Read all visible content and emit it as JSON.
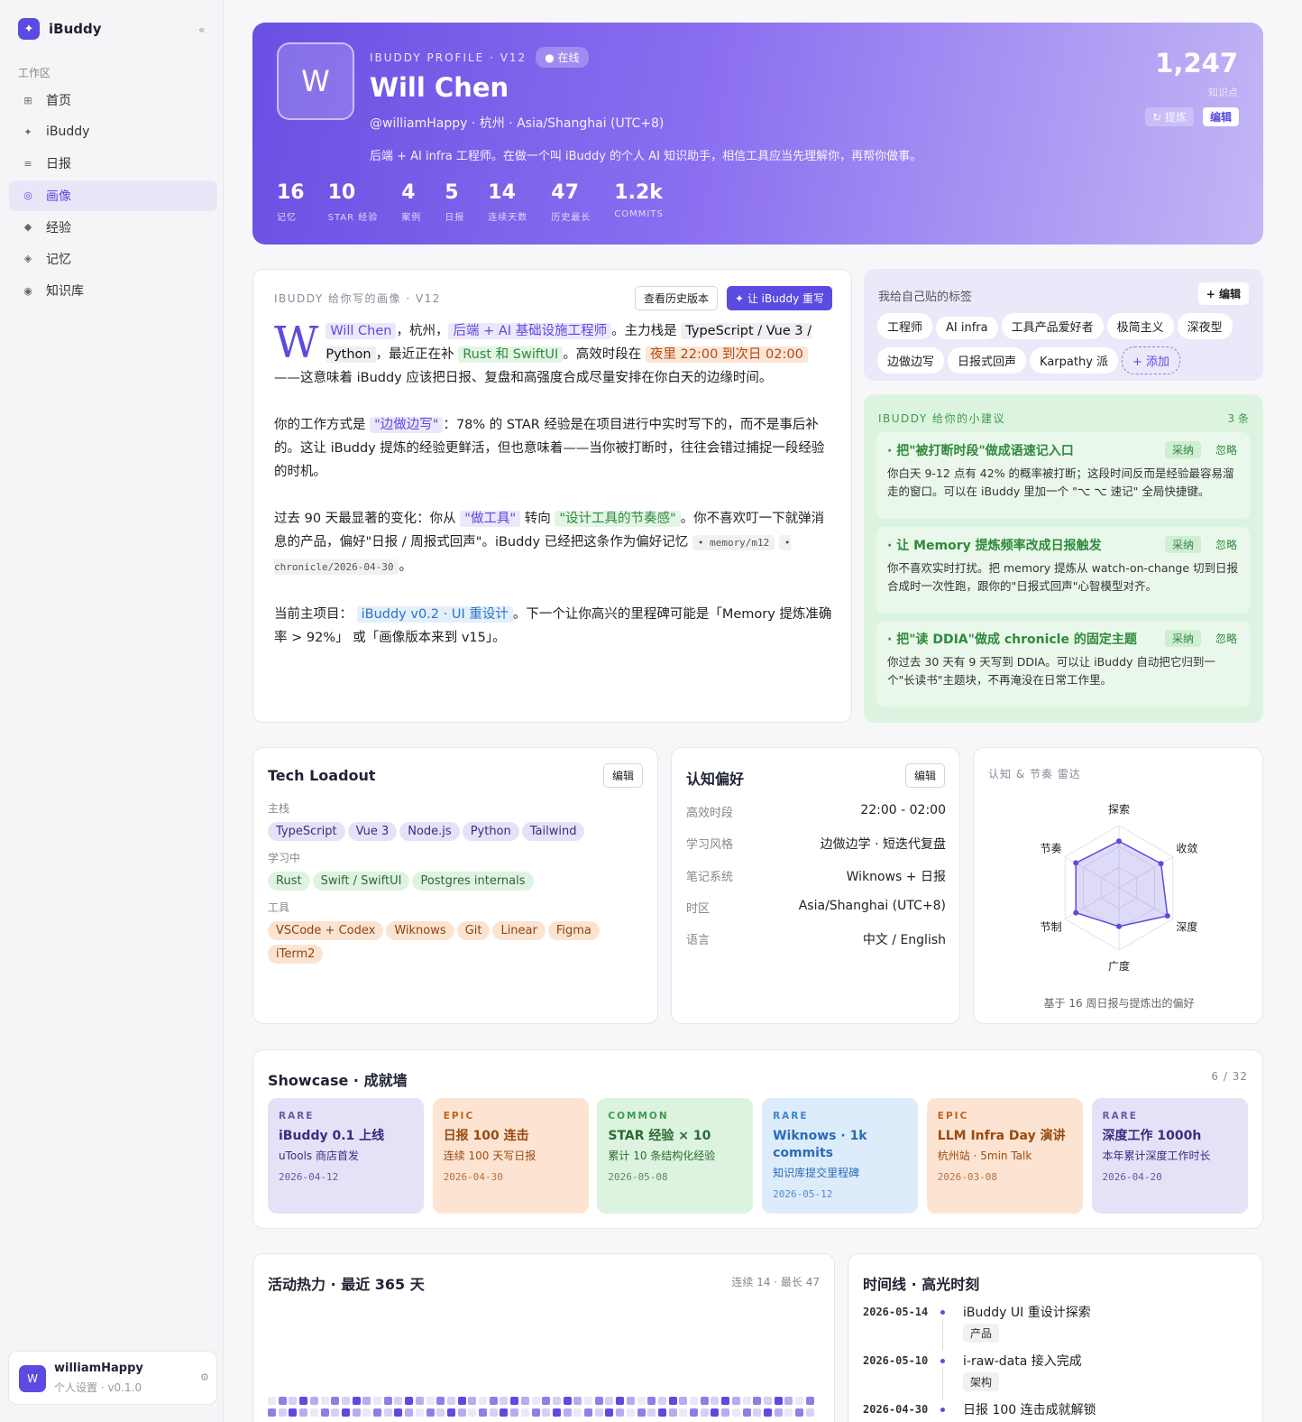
{
  "app": {
    "name": "iBuddy",
    "collapse": "«"
  },
  "sidebar": {
    "section": "工作区",
    "items": [
      {
        "label": "首页",
        "icon": "grid-icon",
        "glyph": "⊞"
      },
      {
        "label": "iBuddy",
        "icon": "sparkle-icon",
        "glyph": "✦"
      },
      {
        "label": "日报",
        "icon": "list-icon",
        "glyph": "≡"
      },
      {
        "label": "画像",
        "icon": "target-icon",
        "glyph": "◎",
        "active": true
      },
      {
        "label": "经验",
        "icon": "diamond-icon",
        "glyph": "◆"
      },
      {
        "label": "记忆",
        "icon": "diamond-outline-icon",
        "glyph": "◈"
      },
      {
        "label": "知识库",
        "icon": "record-icon",
        "glyph": "◉"
      }
    ],
    "user": {
      "avatar": "W",
      "name": "williamHappy",
      "sub": "个人设置 · v0.1.0",
      "gear": "⚙"
    }
  },
  "hero": {
    "avatar": "W",
    "kicker": "IBUDDY PROFILE · V12",
    "status": "在线",
    "name": "Will Chen",
    "handle": "@williamHappy · 杭州 · Asia/Shanghai (UTC+8)",
    "bio": "后端 + AI infra 工程师。在做一个叫 iBuddy 的个人 AI 知识助手，相信工具应当先理解你，再帮你做事。",
    "stats": [
      {
        "value": "16",
        "label": "记忆"
      },
      {
        "value": "10",
        "label": "STAR 经验"
      },
      {
        "value": "4",
        "label": "案例"
      },
      {
        "value": "5",
        "label": "日报"
      },
      {
        "value": "14",
        "label": "连续天数"
      },
      {
        "value": "47",
        "label": "历史最长"
      },
      {
        "value": "1.2k",
        "label": "COMMITS"
      }
    ],
    "count": "1,247",
    "count_label": "知识点",
    "refine": "↻ 提炼",
    "edit": "编辑"
  },
  "portrait": {
    "kicker": "IBUDDY 给你写的画像 · V12",
    "history_btn": "查看历史版本",
    "rewrite_btn": "✦ 让 iBuddy 重写",
    "dropcap": "W",
    "p1": {
      "name": "Will Chen",
      "t1": "，杭州，",
      "role": "后端 + AI 基础设施工程师",
      "t2": "。主力栈是",
      "stack": "TypeScript / Vue 3 / Python",
      "t3": "，最近正在补",
      "learning": "Rust 和 SwiftUI",
      "t4": "。高效时段在",
      "hours": "夜里 22:00 到次日 02:00",
      "t5": "——这意味着 iBuddy 应该把日报、复盘和高强度合成尽量安排在你白天的边缘时间。"
    },
    "p2": {
      "t1": "你的工作方式是",
      "style": "\"边做边写\"",
      "t2": "：78% 的 STAR 经验是在项目进行中实时写下的，而不是事后补的。这让 iBuddy 提炼的经验更鲜活，但也意味着——当你被打断时，往往会错过捕捉一段经验的时机。"
    },
    "p3": {
      "t1": "过去 90 天最显著的变化：你从",
      "from": "\"做工具\"",
      "t2": "转向",
      "to": "\"设计工具的节奏感\"",
      "t3": "。你不喜欢叮一下就弹消息的产品，偏好\"日报 / 周报式回声\"。iBuddy 已经把这条作为偏好记忆",
      "ref1": "• memory/m12",
      "ref2": "• chronicle/2026-04-30",
      "t4": "。"
    },
    "p4": {
      "t1": "当前主项目：",
      "project": "iBuddy v0.2 · UI 重设计",
      "t2": "。下一个让你高兴的里程碑可能是「Memory 提炼准确率 > 92%」 或「画像版本来到 v15」。"
    }
  },
  "tags": {
    "title": "我给自己贴的标签",
    "edit": "+ 编辑",
    "items": [
      "工程师",
      "AI infra",
      "工具产品爱好者",
      "极简主义",
      "深夜型",
      "边做边写",
      "日报式回声",
      "Karpathy 派"
    ],
    "add": "+ 添加"
  },
  "suggestions": {
    "title": "IBUDDY 给你的小建议",
    "count": "3 条",
    "accept": "采纳",
    "ignore": "忽略",
    "items": [
      {
        "title": "· 把\"被打断时段\"做成语速记入口",
        "desc": "你白天 9-12 点有 42% 的概率被打断；这段时间反而是经验最容易溜走的窗口。可以在 iBuddy 里加一个 \"⌥ ⌥ 速记\" 全局快捷键。"
      },
      {
        "title": "· 让 Memory 提炼频率改成日报触发",
        "desc": "你不喜欢实时打扰。把 memory 提炼从 watch-on-change 切到日报合成时一次性跑，跟你的\"日报式回声\"心智模型对齐。"
      },
      {
        "title": "· 把\"读 DDIA\"做成 chronicle 的固定主题",
        "desc": "你过去 30 天有 9 天写到 DDIA。可以让 iBuddy 自动把它归到一个\"长读书\"主题块，不再淹没在日常工作里。"
      }
    ]
  },
  "tech": {
    "title": "Tech Loadout",
    "edit": "编辑",
    "groups": [
      {
        "label": "主栈",
        "items": [
          "TypeScript",
          "Vue 3",
          "Node.js",
          "Python",
          "Tailwind"
        ]
      },
      {
        "label": "学习中",
        "items": [
          "Rust",
          "Swift / SwiftUI",
          "Postgres internals"
        ]
      },
      {
        "label": "工具",
        "items": [
          "VSCode + Codex",
          "Wiknows",
          "Git",
          "Linear",
          "Figma",
          "iTerm2"
        ]
      }
    ]
  },
  "prefs": {
    "title": "认知偏好",
    "edit": "编辑",
    "rows": [
      {
        "k": "高效时段",
        "v": "22:00 - 02:00"
      },
      {
        "k": "学习风格",
        "v": "边做边学 · 短迭代复盘"
      },
      {
        "k": "笔记系统",
        "v": "Wiknows + 日报"
      },
      {
        "k": "时区",
        "v": "Asia/Shanghai (UTC+8)"
      },
      {
        "k": "语言",
        "v": "中文 / English"
      }
    ]
  },
  "radar": {
    "title": "认知 & 节奏 雷达",
    "caption": "基于 16 周日报与提炼出的偏好",
    "chart_data": {
      "type": "radar",
      "axes": [
        "探索",
        "收敛",
        "深度",
        "广度",
        "节制",
        "节奏"
      ],
      "values": [
        0.75,
        0.78,
        0.9,
        0.62,
        0.8,
        0.8
      ],
      "range": [
        0,
        1
      ]
    }
  },
  "showcase": {
    "title": "Showcase · 成就墙",
    "count": "6 / 32",
    "items": [
      {
        "rarity": "RARE",
        "title": "iBuddy 0.1 上线",
        "sub": "uTools 商店首发",
        "date": "2026-04-12",
        "bg": "#e6e1f7",
        "fg": "#3c2c80",
        "rc": "#6a5aa8"
      },
      {
        "rarity": "EPIC",
        "title": "日报 100 连击",
        "sub": "连续 100 天写日报",
        "date": "2026-04-30",
        "bg": "#fde4d2",
        "fg": "#9a4a10",
        "rc": "#c0621c"
      },
      {
        "rarity": "COMMON",
        "title": "STAR 经验 × 10",
        "sub": "累计 10 条结构化经验",
        "date": "2026-05-08",
        "bg": "#dcf3df",
        "fg": "#2b6b33",
        "rc": "#3f9a4c"
      },
      {
        "rarity": "RARE",
        "title": "Wiknows · 1k commits",
        "sub": "知识库提交里程碑",
        "date": "2026-05-12",
        "bg": "#dcecfa",
        "fg": "#2a6bb8",
        "rc": "#3f84cf"
      },
      {
        "rarity": "EPIC",
        "title": "LLM Infra Day 演讲",
        "sub": "杭州站 · 5min Talk",
        "date": "2026-03-08",
        "bg": "#fde4d2",
        "fg": "#9a4a10",
        "rc": "#c0621c"
      },
      {
        "rarity": "RARE",
        "title": "深度工作 1000h",
        "sub": "本年累计深度工作时长",
        "date": "2026-04-20",
        "bg": "#e6e1f7",
        "fg": "#3c2c80",
        "rc": "#6a5aa8"
      }
    ]
  },
  "heatmap": {
    "title": "活动热力 · 最近 365 天",
    "meta": "连续 14 · 最长 47"
  },
  "timeline": {
    "title": "时间线 · 高光时刻",
    "items": [
      {
        "date": "2026-05-14",
        "text": "iBuddy UI 重设计探索",
        "tag": "产品"
      },
      {
        "date": "2026-05-10",
        "text": "i-raw-data 接入完成",
        "tag": "架构"
      },
      {
        "date": "2026-04-30",
        "text": "日报 100 连击成就解锁"
      }
    ]
  }
}
